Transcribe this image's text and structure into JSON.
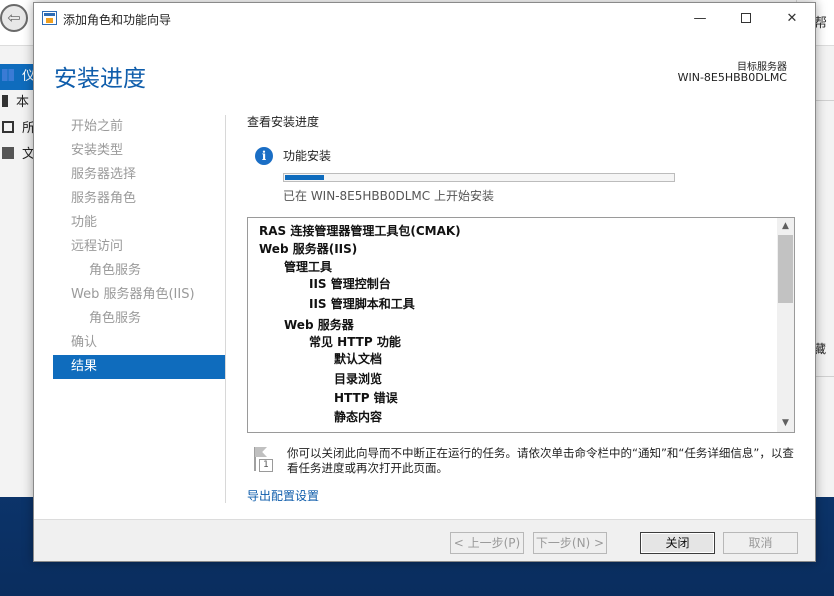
{
  "background_window": {
    "help_label": "帮",
    "nav_items": [
      {
        "label": "仪",
        "selected": true
      },
      {
        "label": "本",
        "selected": false
      },
      {
        "label": "所",
        "selected": false
      },
      {
        "label": "文",
        "selected": false
      }
    ],
    "right_text": "藏"
  },
  "dialog": {
    "title": "添加角色和功能向导",
    "window_buttons": {
      "minimize": "—",
      "close": "✕"
    }
  },
  "header": {
    "page_title": "安装进度",
    "destination_label": "目标服务器",
    "destination_server": "WIN-8E5HBB0DLMC"
  },
  "steps": [
    {
      "label": "开始之前",
      "level": 0,
      "state": "done"
    },
    {
      "label": "安装类型",
      "level": 0,
      "state": "done"
    },
    {
      "label": "服务器选择",
      "level": 0,
      "state": "done"
    },
    {
      "label": "服务器角色",
      "level": 0,
      "state": "done"
    },
    {
      "label": "功能",
      "level": 0,
      "state": "done"
    },
    {
      "label": "远程访问",
      "level": 0,
      "state": "done"
    },
    {
      "label": "角色服务",
      "level": 1,
      "state": "done"
    },
    {
      "label": "Web 服务器角色(IIS)",
      "level": 0,
      "state": "done"
    },
    {
      "label": "角色服务",
      "level": 1,
      "state": "done"
    },
    {
      "label": "确认",
      "level": 0,
      "state": "done"
    },
    {
      "label": "结果",
      "level": 0,
      "state": "active"
    }
  ],
  "progress": {
    "section_title": "查看安装进度",
    "feature_label": "功能安装",
    "fraction": 0.1,
    "status_text": "已在 WIN-8E5HBB0DLMC 上开始安装"
  },
  "install_items": [
    {
      "label": "RAS 连接管理器管理工具包(CMAK)",
      "level": 0
    },
    {
      "label": "Web 服务器(IIS)",
      "level": 0
    },
    {
      "label": "管理工具",
      "level": 1
    },
    {
      "label": "IIS 管理控制台",
      "level": 2
    },
    {
      "label": "IIS 管理脚本和工具",
      "level": 2
    },
    {
      "label": "Web 服务器",
      "level": 1
    },
    {
      "label": "常见 HTTP 功能",
      "level": 2
    },
    {
      "label": "默认文档",
      "level": 3
    },
    {
      "label": "目录浏览",
      "level": 3
    },
    {
      "label": "HTTP 错误",
      "level": 3
    },
    {
      "label": "静态内容",
      "level": 3
    }
  ],
  "note": {
    "icon_number": "1",
    "text": "你可以关闭此向导而不中断正在运行的任务。请依次单击命令栏中的“通知”和“任务详细信息”，以查看任务进度或再次打开此页面。"
  },
  "export_link": "导出配置设置",
  "footer": {
    "prev_label": "< 上一步(P)",
    "next_label": "下一步(N) >",
    "close_label": "关闭",
    "cancel_label": "取消"
  },
  "colors": {
    "accent": "#0f6cbd",
    "title_blue": "#0f5dab"
  }
}
